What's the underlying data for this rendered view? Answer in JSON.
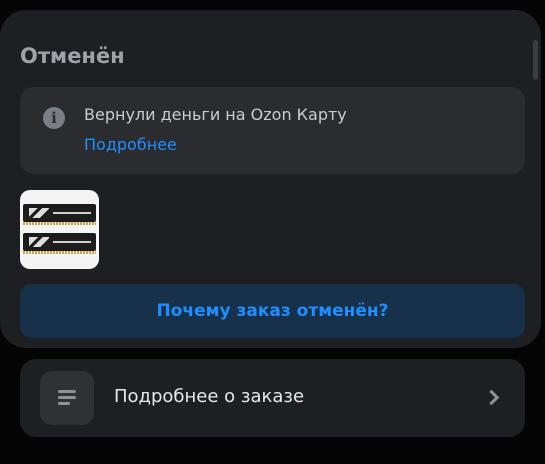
{
  "order": {
    "status": "Отменён",
    "info_message": "Вернули деньги на Ozon Карту",
    "info_link": "Подробнее",
    "info_icon": "info-icon",
    "product_image": "ram-memory-modules",
    "why_button_label": "Почему заказ отменён?"
  },
  "details": {
    "label": "Подробнее о заказе",
    "icon": "list-icon",
    "arrow_icon": "chevron-right-icon"
  },
  "colors": {
    "link": "#1f8fff",
    "button_bg": "#163149",
    "card_bg": "#1d1f22"
  }
}
